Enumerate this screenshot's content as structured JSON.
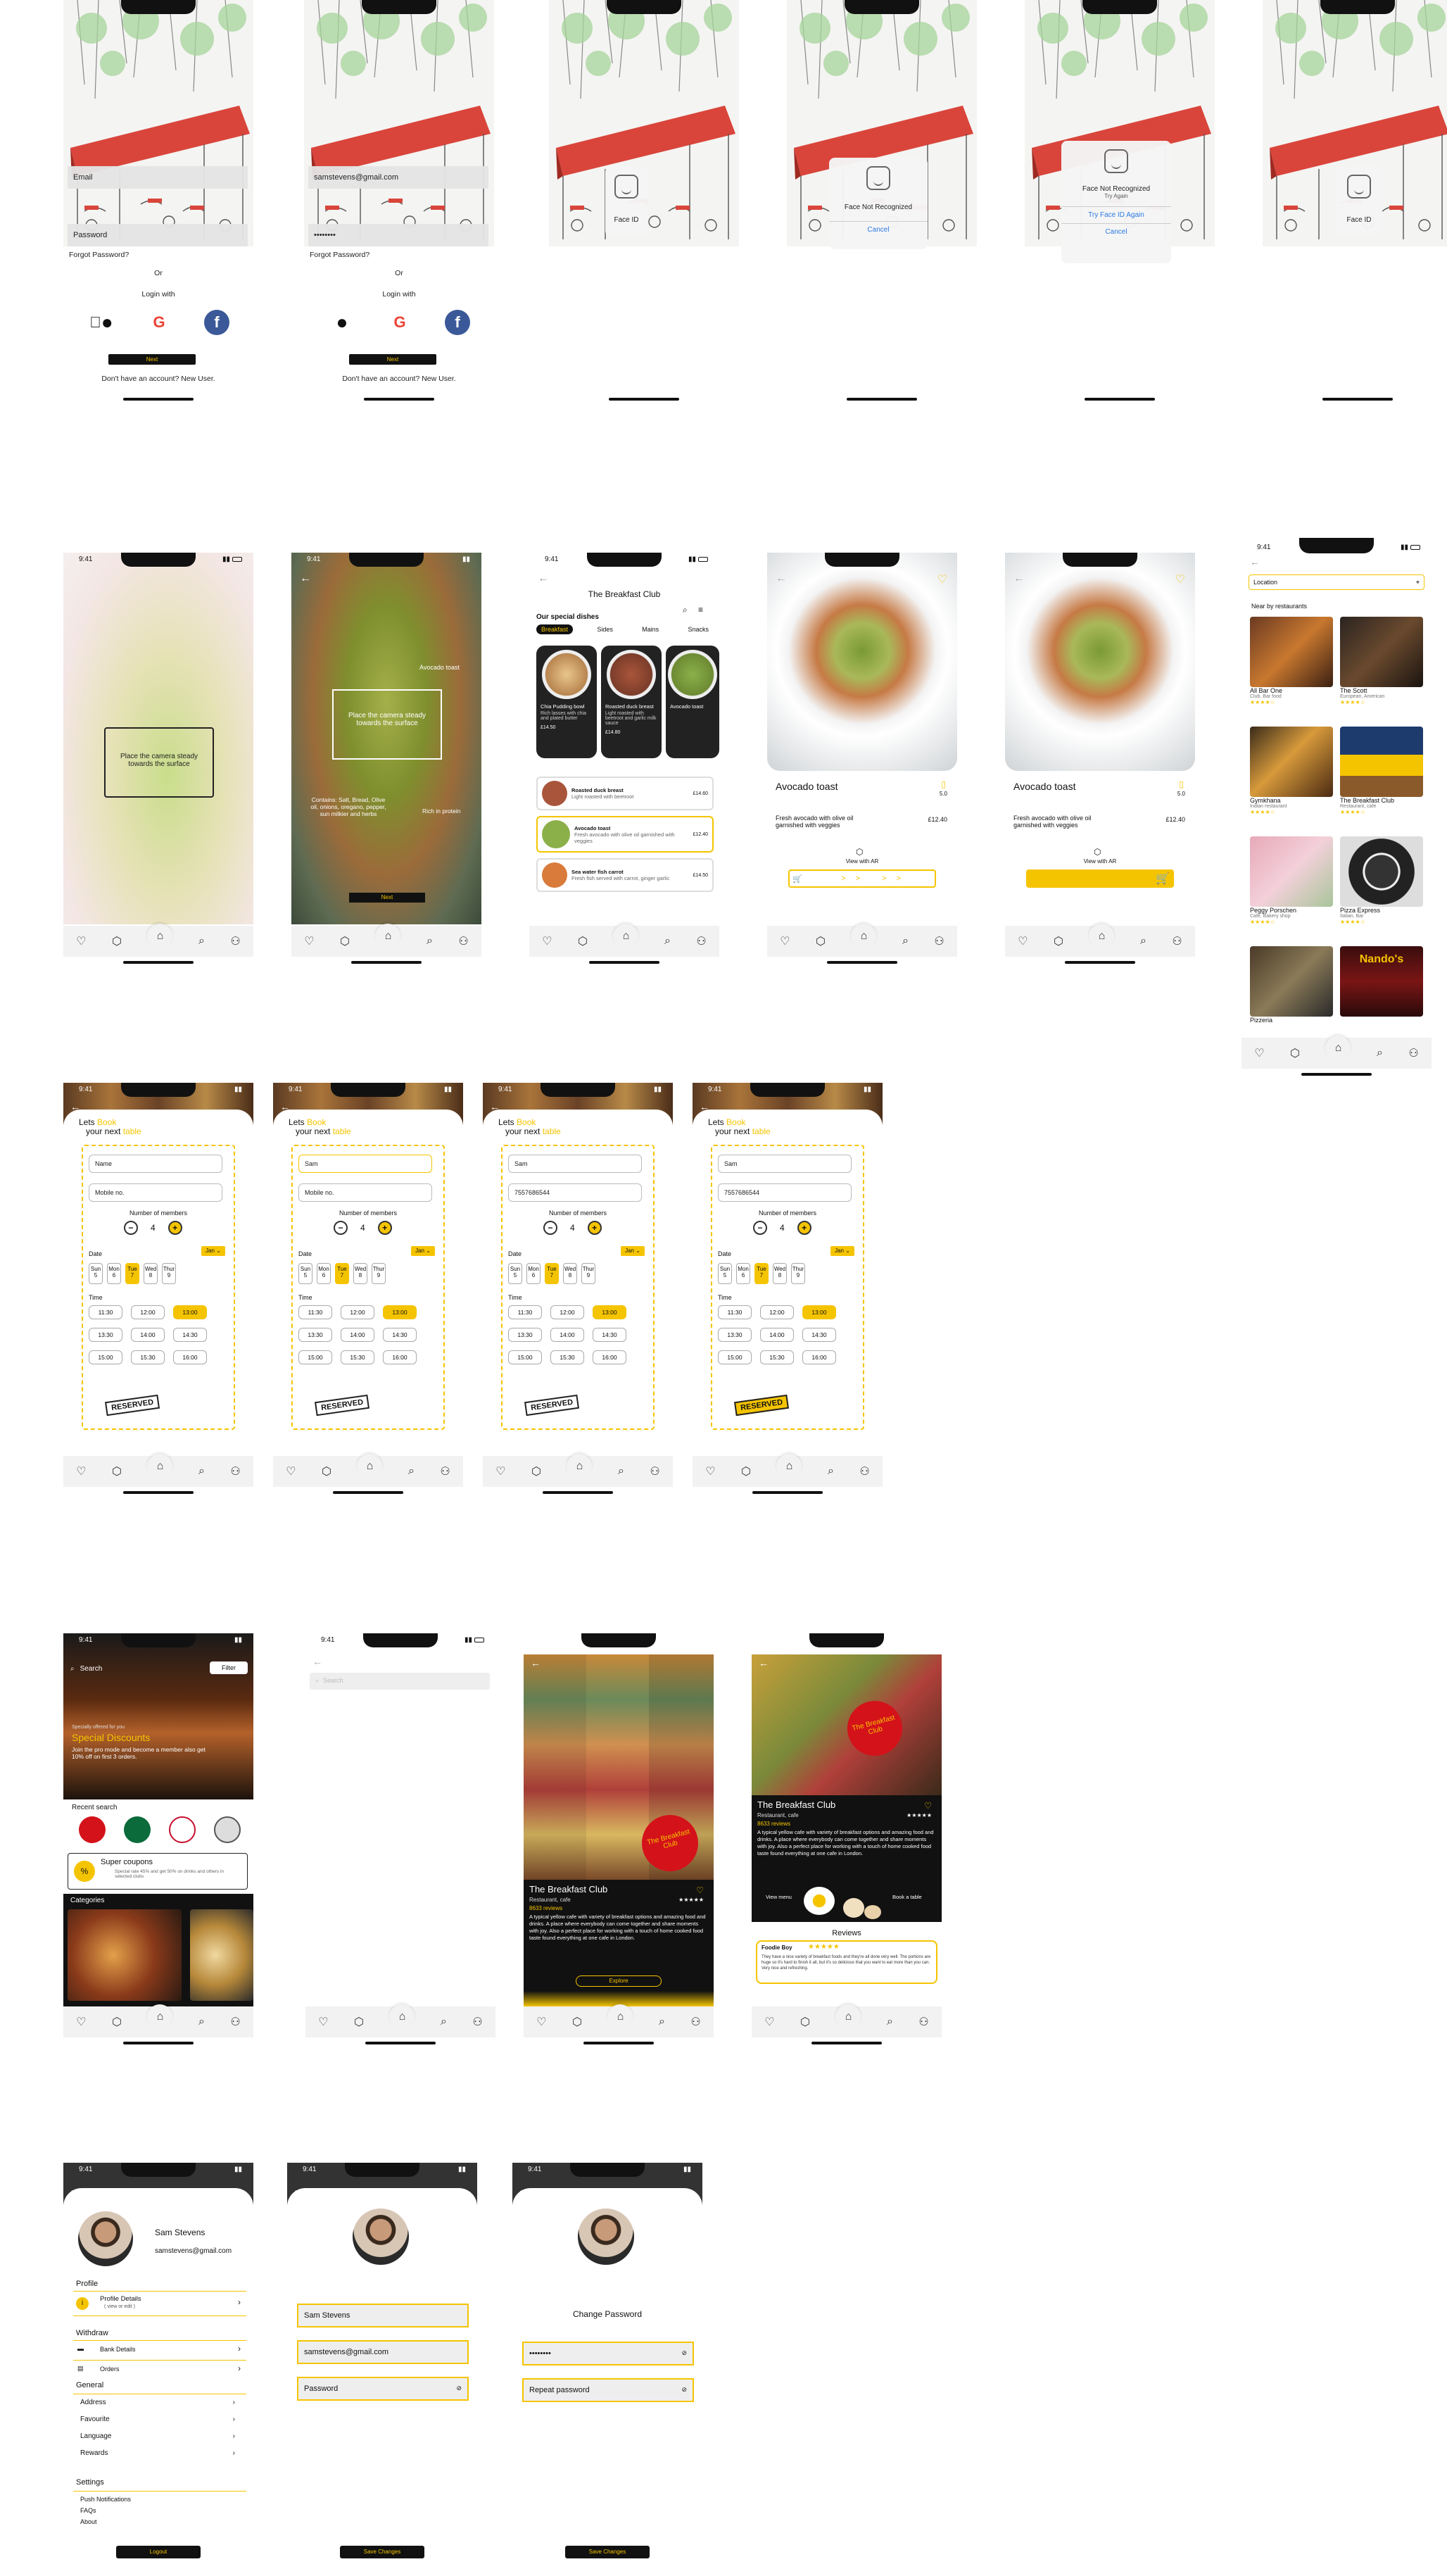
{
  "status_time": "9:41",
  "colors": {
    "accent": "#f5c400",
    "dark": "#111111",
    "link": "#2a7ae2"
  },
  "login": {
    "email_placeholder": "Email",
    "email_value": "samstevens@gmail.com",
    "password_placeholder": "Password",
    "password_value": "••••••••",
    "forgot": "Forgot Password?",
    "or": "Or",
    "login_with": "Login with",
    "next": "Next",
    "signup": "Don't have an account? New User.",
    "social": [
      "apple-icon",
      "google-icon",
      "facebook-icon"
    ]
  },
  "faceid": {
    "label": "Face ID",
    "not_recognized": "Face Not Recognized",
    "try_again": "Try Again",
    "try_face_id_again": "Try Face ID Again",
    "cancel": "Cancel"
  },
  "ar": {
    "hint": "Place the camera steady towards the surface",
    "labels": [
      "Avocado toast",
      "Contains: Salt, Bread, Olive oil, onions, oregano, pepper, sun milkier and herbs",
      "Rich in protein"
    ],
    "next": "Next"
  },
  "menu": {
    "title": "The Breakfast Club",
    "section": "Our special dishes",
    "tabs": [
      "Breakfast",
      "Sides",
      "Mains",
      "Snacks"
    ],
    "cards": [
      {
        "name": "Chia Pudding bowl",
        "desc": "Rich lasses with chia and plated butter",
        "price": "£14.50"
      },
      {
        "name": "Roasted duck breast",
        "desc": "Light roasted with beetroot and garlic milk sauce",
        "price": "£14.80"
      },
      {
        "name": "Avocado toast",
        "desc": "",
        "price": ""
      }
    ],
    "list": [
      {
        "name": "Roasted duck breast",
        "desc": "Light roasted with beetroot",
        "price": "£14.60"
      },
      {
        "name": "Avocado toast",
        "desc": "Fresh avocado with olive oil garnished with veggies",
        "price": "£12.40"
      },
      {
        "name": "Sea water fish carrot",
        "desc": "Fresh fish served with carrot, ginger garlic",
        "price": "£14.50"
      }
    ]
  },
  "dish": {
    "name": "Avocado toast",
    "rating": "5.0",
    "desc": "Fresh avocado with olive oil garnished with veggies",
    "price": "£12.40",
    "view_ar": "View with AR",
    "slide": ">> >>"
  },
  "nearby": {
    "search_placeholder": "Location",
    "heading": "Near by restaurants",
    "items": [
      {
        "name": "All Bar One",
        "sub": "Club, Bar food"
      },
      {
        "name": "The Scott",
        "sub": "European, American"
      },
      {
        "name": "Gymkhana",
        "sub": "Indian restaurant"
      },
      {
        "name": "The Breakfast Club",
        "sub": "Restaurant, cafe"
      },
      {
        "name": "Peggy Porschen",
        "sub": "Café, Bakery shop"
      },
      {
        "name": "Pizza Express",
        "sub": "Italian, Bar"
      },
      {
        "name": "Pizzeria",
        "sub": ""
      },
      {
        "name": "Nando's",
        "sub": ""
      }
    ]
  },
  "booking": {
    "lets": "Lets",
    "book": "Book",
    "your_next": "your next",
    "table": "table",
    "name_placeholder": "Name",
    "mobile_placeholder": "Mobile no.",
    "name_value": "Sam",
    "mobile_value": "7557686544",
    "members_label": "Number of members",
    "members": "4",
    "date_label": "Date",
    "month": "Jan",
    "days": [
      {
        "d": "Sun",
        "n": "5"
      },
      {
        "d": "Mon",
        "n": "6"
      },
      {
        "d": "Tue",
        "n": "7"
      },
      {
        "d": "Wed",
        "n": "8"
      },
      {
        "d": "Thur",
        "n": "9"
      }
    ],
    "time_label": "Time",
    "times": [
      "11:30",
      "12:00",
      "13:00",
      "13:30",
      "14:00",
      "14:30",
      "15:00",
      "15:30",
      "16:00"
    ],
    "reserved": "RESERVED"
  },
  "search": {
    "placeholder": "Search",
    "filter": "Filter",
    "promo_small": "Specially offered for you",
    "promo_title": "Special Discounts",
    "promo_desc": "Join the pro mode and become a member also get 10% off on first 3 orders.",
    "recent": "Recent search",
    "coupon_title": "Super coupons",
    "coupon_desc": "Special rate 45% and get 50% on drinks and others in selected clubs",
    "categories": "Categories"
  },
  "restaurant": {
    "name": "The Breakfast Club",
    "type": "Restaurant, cafe",
    "reviews_count": "8633 reviews",
    "desc": "A typical yellow cafe with variety of breakfast options and amazing food and drinks. A place where everybody can come together and share moments with joy. Also a perfect place for working with a touch of home cooked food taste found everything at one cafe in London.",
    "explore": "Explore",
    "view_menu": "View menu",
    "book_table": "Book a table",
    "reviews_heading": "Reviews",
    "reviewer": "Foodie Boy",
    "review_text": "They have a nice variety of breakfast foods and they're all done very well. The portions are huge so it's hard to finish it all, but it's so delicious that you want to eat more than you can. Very nice and refreshing."
  },
  "profile": {
    "name": "Sam Stevens",
    "email": "samstevens@gmail.com",
    "sec_profile": "Profile",
    "profile_details": "Profile Details",
    "profile_sub": "( view or edit )",
    "sec_withdraw": "Withdraw",
    "bank": "Bank Details",
    "orders": "Orders",
    "sec_general": "General",
    "general": [
      "Address",
      "Favourite",
      "Language",
      "Rewards"
    ],
    "sec_settings": "Settings",
    "settings": [
      "Push Notifications",
      "FAQs",
      "About"
    ],
    "logout": "Logout",
    "save": "Save Changes",
    "password_placeholder": "Password",
    "change_password": "Change Password",
    "new_password": "••••••••",
    "repeat_password": "Repeat password"
  }
}
